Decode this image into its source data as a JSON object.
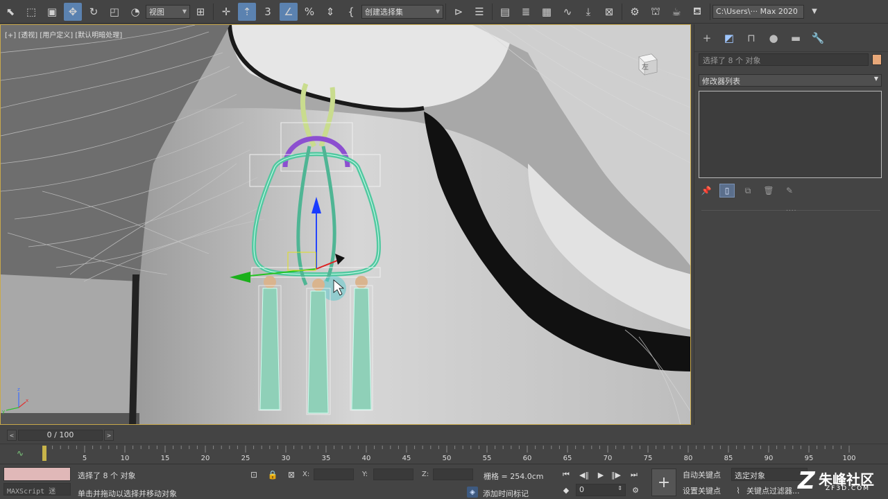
{
  "toolbar": {
    "view_dropdown": "视图",
    "selection_set_dropdown": "创建选择集",
    "path_field": "C:\\Users\\··· Max 2020",
    "icons": [
      "select-object-icon",
      "rect-select-region-icon",
      "window-crossing-icon",
      "select-move-icon",
      "select-rotate-icon",
      "select-scale-icon",
      "select-place-icon",
      "use-pivot-icon",
      "select-manipulate-icon",
      "keyboard-shortcut-override-icon",
      "snaps-toggle-icon",
      "angle-snap-icon",
      "percent-snap-icon",
      "spinner-snap-icon",
      "edit-named-selection-icon",
      "mirror-icon",
      "align-icon",
      "toggle-scene-explorer-icon",
      "toggle-layer-explorer-icon",
      "toggle-ribbon-icon",
      "curve-editor-icon",
      "schematic-view-icon",
      "material-editor-icon",
      "render-setup-icon",
      "rendered-frame-window-icon",
      "render-production-icon",
      "render-activeshade-icon"
    ]
  },
  "viewport": {
    "label": "[+] [透视] [用户定义] [默认明暗处理]",
    "viewcube_label": "左"
  },
  "command_panel": {
    "tabs": [
      "create-tab",
      "modify-tab",
      "hierarchy-tab",
      "motion-tab",
      "display-tab",
      "utilities-tab"
    ],
    "selection_text": "选择了 8 个 对象",
    "modifier_list": "修改器列表",
    "stack_divider": "....",
    "accent_color": "#e8a879"
  },
  "timeline": {
    "frame_display": "0 / 100",
    "ticks": [
      "5",
      "10",
      "15",
      "20",
      "25",
      "30",
      "35",
      "40",
      "45",
      "50",
      "55",
      "60",
      "65",
      "70",
      "75",
      "80",
      "85",
      "90",
      "95",
      "100"
    ]
  },
  "status": {
    "maxscript_label": "MAXScript 迷",
    "selection_count": "选择了 8 个 对象",
    "prompt": "单击并拖动以选择并移动对象",
    "x_label": "X:",
    "y_label": "Y:",
    "z_label": "Z:",
    "grid": "栅格 = 254.0cm",
    "add_time_tag": "添加时间标记",
    "auto_key": "自动关键点",
    "set_key": "设置关键点",
    "selected_dropdown": "选定对象",
    "key_filter": "关键点过滤器...",
    "current_frame": "0"
  },
  "watermark": {
    "brand": "朱峰社区",
    "url": "ZF3D.COM"
  }
}
